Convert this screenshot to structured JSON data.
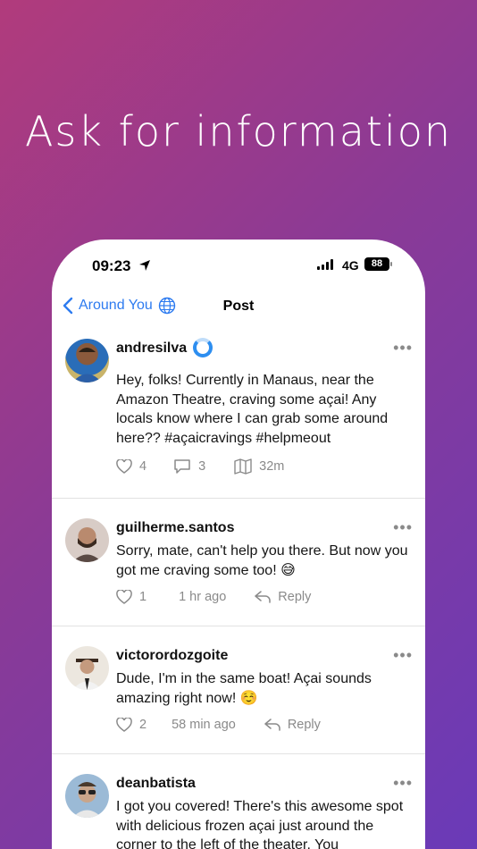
{
  "headline": "Ask for information",
  "status": {
    "time": "09:23",
    "network": "4G",
    "battery": "88"
  },
  "nav": {
    "back_label": "Around You",
    "title": "Post"
  },
  "post": {
    "username": "andresilva",
    "text": "Hey, folks! Currently in Manaus, near the Amazon Theatre, craving some açai! Any locals know where I can grab some around here?? #açaicravings #helpmeout",
    "likes": "4",
    "comments": "3",
    "distance": "32m"
  },
  "replies": [
    {
      "username": "guilherme.santos",
      "text": "Sorry, mate, can't help you there. But now you got me craving some too! 😅",
      "likes": "1",
      "time": "1 hr ago",
      "reply_label": "Reply"
    },
    {
      "username": "victorordozgoite",
      "text": "Dude, I'm in the same boat! Açai sounds amazing right now! ☺️",
      "likes": "2",
      "time": "58 min ago",
      "reply_label": "Reply"
    },
    {
      "username": "deanbatista",
      "text": "I got you covered! There's this awesome spot with delicious frozen açai just around the corner to the left of the theater. You",
      "likes": "",
      "time": "",
      "reply_label": ""
    }
  ],
  "colors": {
    "accent": "#2d7bf0",
    "muted": "#8a8a8a",
    "gradient_start": "#b13b7c",
    "gradient_end": "#6a3ab8"
  },
  "icons": [
    "location-arrow-icon",
    "signal-icon",
    "chevron-left-icon",
    "globe-icon",
    "verified-ring-icon",
    "more-icon",
    "heart-icon",
    "comment-icon",
    "map-icon",
    "reply-icon"
  ]
}
